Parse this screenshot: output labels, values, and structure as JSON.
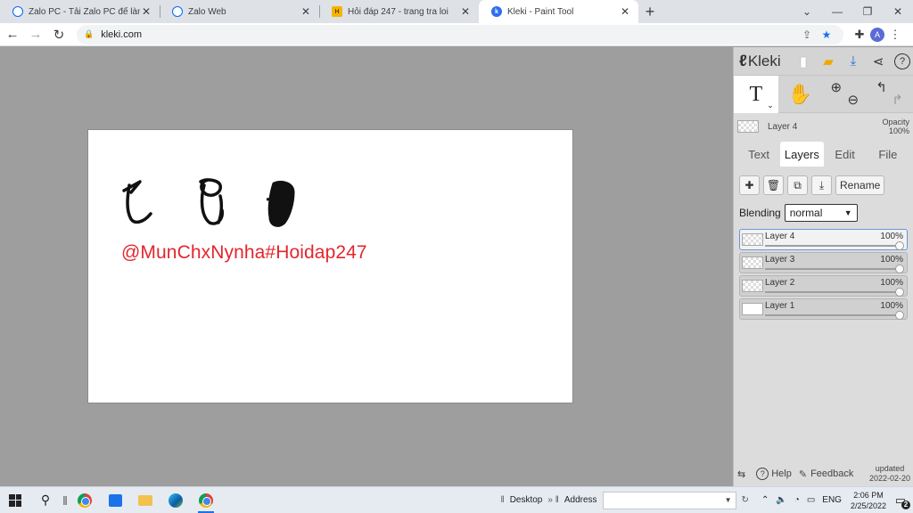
{
  "browser": {
    "tabs": [
      {
        "title": "Zalo PC - Tải Zalo PC để làm việc",
        "icon": "zalo-icon",
        "active": false
      },
      {
        "title": "Zalo Web",
        "icon": "zalo-icon",
        "active": false
      },
      {
        "title": "Hỏi đáp 247 - trang tra loi",
        "icon": "hoidap247-icon",
        "active": false
      },
      {
        "title": "Kleki - Paint Tool",
        "icon": "kleki-icon",
        "active": true
      }
    ],
    "url": "kleki.com"
  },
  "canvas": {
    "text": "@MunChxNynha#Hoidap247",
    "text_color": "#e3262d",
    "background": "#ffffff"
  },
  "kleki": {
    "brand": "Kleki",
    "current_layer": {
      "name": "Layer 4",
      "opacity_label": "Opacity",
      "opacity_value": "100%"
    },
    "tabs": [
      "Text",
      "Layers",
      "Edit",
      "File"
    ],
    "active_tab": "Layers",
    "rename_label": "Rename",
    "blending_label": "Blending",
    "blending_value": "normal",
    "layers": [
      {
        "name": "Layer 4",
        "opacity": "100%",
        "selected": true
      },
      {
        "name": "Layer 3",
        "opacity": "100%",
        "selected": false
      },
      {
        "name": "Layer 2",
        "opacity": "100%",
        "selected": false
      },
      {
        "name": "Layer 1",
        "opacity": "100%",
        "selected": false
      }
    ],
    "footer": {
      "help": "Help",
      "feedback": "Feedback",
      "updated_label": "updated",
      "updated_date": "2022-02-20"
    }
  },
  "taskbar": {
    "desktop_label": "Desktop",
    "address_label": "Address",
    "language": "ENG",
    "time": "2:06 PM",
    "date": "2/25/2022",
    "notification_count": "2"
  },
  "colors": {
    "accent": "#1a73e8",
    "canvas_text": "#e3262d",
    "panel_bg": "#dcdcdc",
    "workspace_bg": "#9e9e9e"
  }
}
